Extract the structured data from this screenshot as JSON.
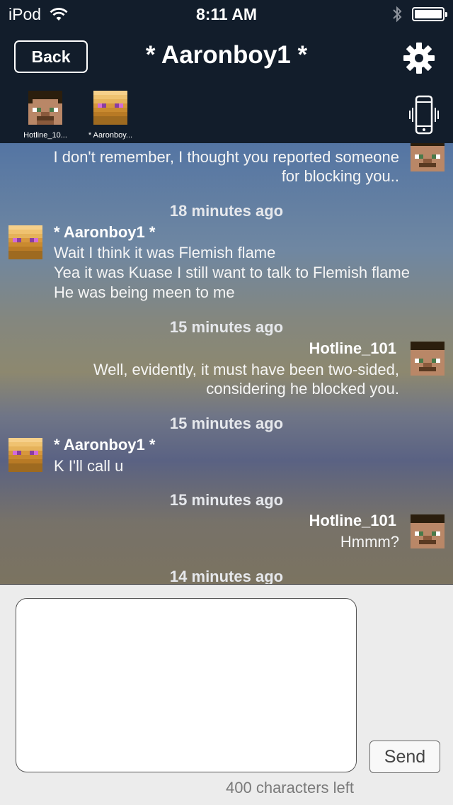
{
  "status_bar": {
    "carrier": "iPod",
    "time": "8:11 AM"
  },
  "nav": {
    "back_label": "Back",
    "title": "* Aaronboy1 *"
  },
  "participants": [
    {
      "label": "Hotline_10...",
      "avatar": "steve-head"
    },
    {
      "label": "* Aaronboy...",
      "avatar": "enderman-like-head"
    }
  ],
  "chat": {
    "top_message": {
      "lines": [
        "I don't remember, I thought you reported someone",
        "for blocking you.."
      ]
    },
    "entries": [
      {
        "timestamp": "18 minutes ago",
        "sender": "* Aaronboy1 *",
        "side": "left",
        "lines": [
          "Wait I think it was Flemish flame",
          "Yea it was Kuase I still want to talk to Flemish flame",
          "He was being meen to me"
        ]
      },
      {
        "timestamp": "15 minutes ago",
        "sender": "Hotline_101",
        "side": "right",
        "lines": [
          "Well, evidently, it must have been two-sided,",
          "considering he blocked you."
        ]
      },
      {
        "timestamp": "15 minutes ago",
        "sender": "* Aaronboy1 *",
        "side": "left",
        "lines": [
          "K I'll call u"
        ]
      },
      {
        "timestamp": "15 minutes ago",
        "sender": "Hotline_101",
        "side": "right",
        "lines": [
          "Hmmm?"
        ]
      },
      {
        "timestamp": "14 minutes ago"
      }
    ]
  },
  "composer": {
    "input_value": "",
    "send_label": "Send",
    "chars_left": "400 characters left"
  },
  "colors": {
    "header_bg": "#121d2b",
    "composer_bg": "#ececec"
  },
  "icons": [
    "wifi-icon",
    "bluetooth-icon",
    "battery-icon",
    "gear-icon",
    "vibrate-phone-icon"
  ]
}
